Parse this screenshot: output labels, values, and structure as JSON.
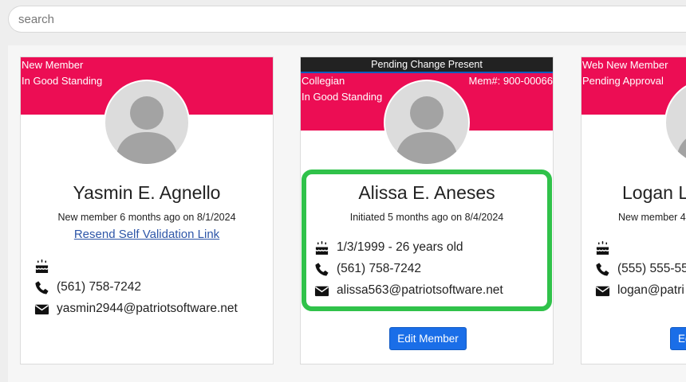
{
  "search": {
    "placeholder": "search",
    "value": ""
  },
  "highlight_color": "#30c24a",
  "header_color": "#ec0d54",
  "cards": [
    {
      "status_line1": "New Member",
      "status_line2": "In Good Standing",
      "name": "Yasmin E. Agnello",
      "subtitle": "New member 6 months ago on 8/1/2024",
      "link": "Resend Self Validation Link",
      "birthday": "",
      "phone": "(561) 758-7242",
      "email": "yasmin2944@patriotsoftware.net"
    },
    {
      "pending": "Pending Change Present",
      "status_line1": "Collegian",
      "status_line2": "In Good Standing",
      "member_number": "Mem#: 900-00066",
      "name": "Alissa E. Aneses",
      "subtitle": "Initiated 5 months ago on 8/4/2024",
      "birthday": "1/3/1999 - 26 years old",
      "phone": "(561) 758-7242",
      "email": "alissa563@patriotsoftware.net",
      "edit_button": "Edit Member"
    },
    {
      "status_line1": "Web New Member",
      "status_line2": "Pending Approval",
      "name": "Logan L",
      "subtitle": "New member 4",
      "birthday": "",
      "phone": "(555) 555-55",
      "email": "logan@patri",
      "edit_button": "Ed"
    }
  ]
}
